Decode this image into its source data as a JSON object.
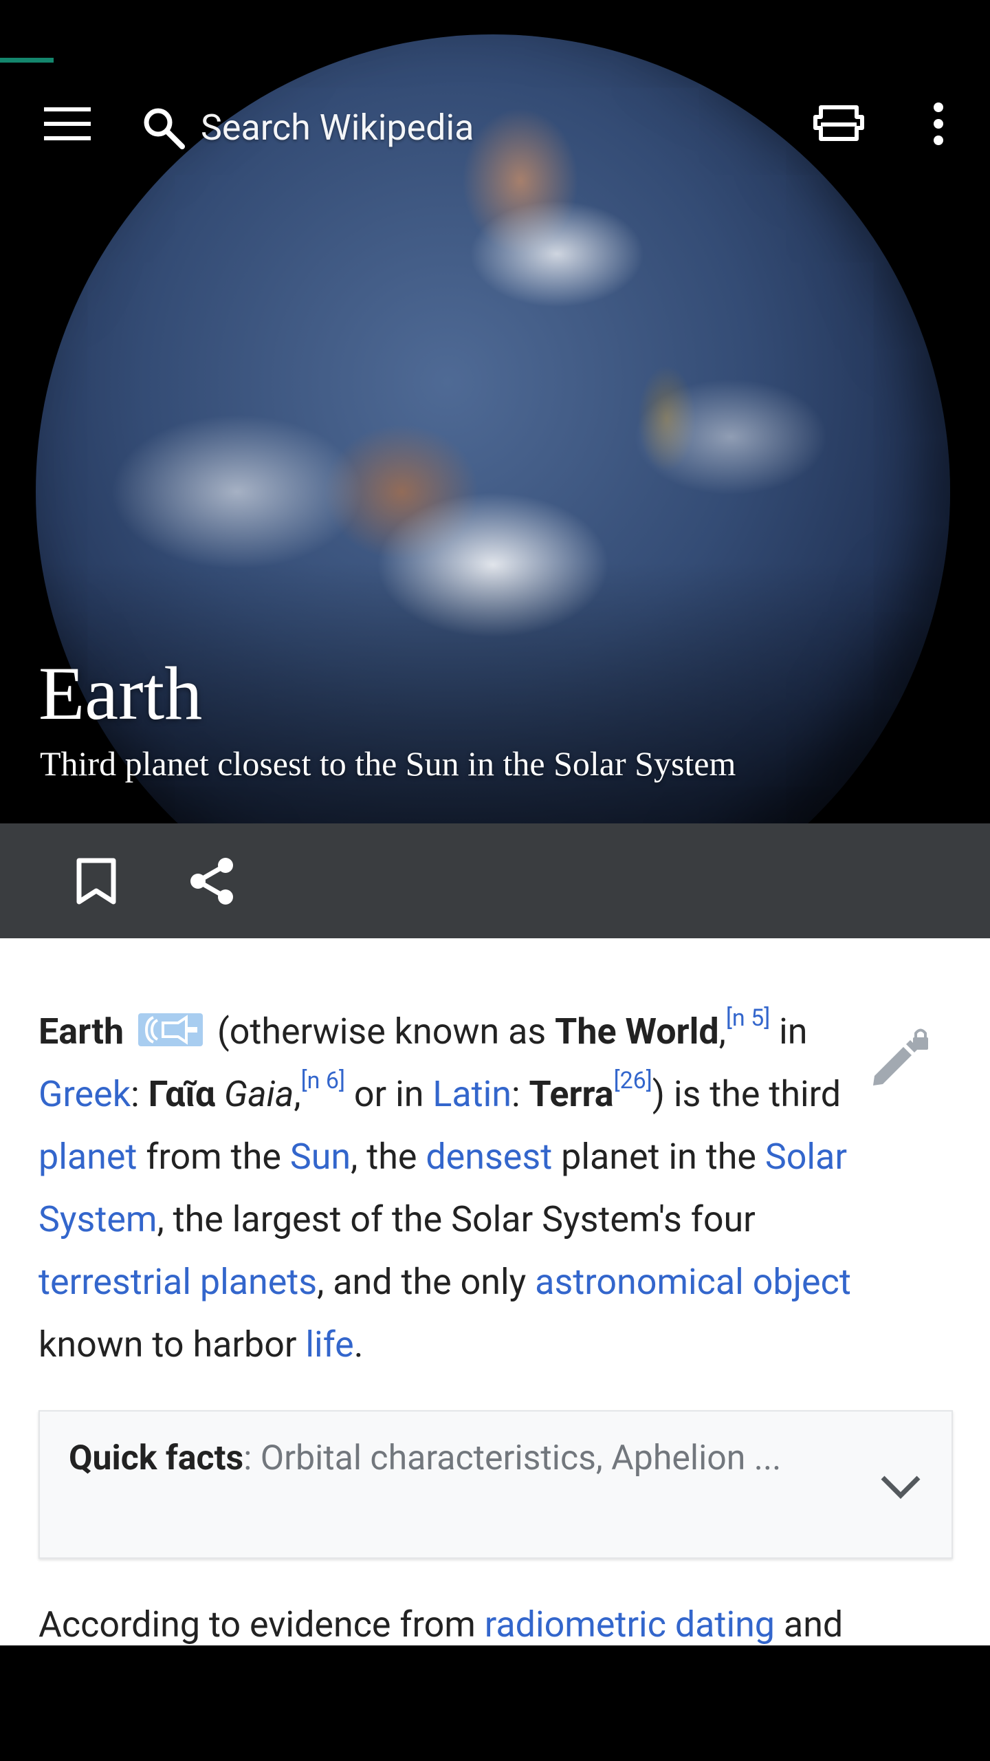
{
  "toolbar": {
    "search_placeholder": "Search Wikipedia"
  },
  "hero": {
    "title": "Earth",
    "description": "Third planet closest to the Sun in the Solar System"
  },
  "colors": {
    "accent_progress": "#14866d",
    "link": "#3366cc",
    "action_bar": "#3a3d40"
  },
  "article": {
    "lead": {
      "earth": "Earth",
      "otherwise": " (otherwise known as ",
      "the_world": "The World",
      "comma1": ",",
      "ref_n5": "[n 5]",
      "in": " in ",
      "greek_link": "Greek",
      "colon1": ": ",
      "gaia_greek": "Γαῖα",
      "gaia_latin": " Gaia",
      "comma2": ",",
      "ref_n6": "[n 6]",
      "or_in": " or in ",
      "latin_link": "Latin",
      "colon2": ": ",
      "terra": "Terra",
      "ref_26": "[26]",
      "is_the_third": ") is the third ",
      "planet_link": "planet",
      "from_the": " from the ",
      "sun_link": "Sun",
      "comma_the": ", the ",
      "densest_link": "densest",
      "planet_in_the": " planet in the ",
      "solar_system_link": "Solar System",
      "largest": ", the largest of the Solar System's four ",
      "terrestrial_link": "terrestrial planets",
      "and_only": ", and the only ",
      "astro_link": "astronomical object",
      "known_to_harbor": " known to harbor ",
      "life_link": "life",
      "period": "."
    },
    "quick_facts": {
      "label": "Quick facts",
      "summary": ": Orbital characteristics, Aphelion ..."
    },
    "next": {
      "start": "According to evidence from ",
      "radiometric_link": "radiometric dating",
      "end": " and"
    }
  }
}
